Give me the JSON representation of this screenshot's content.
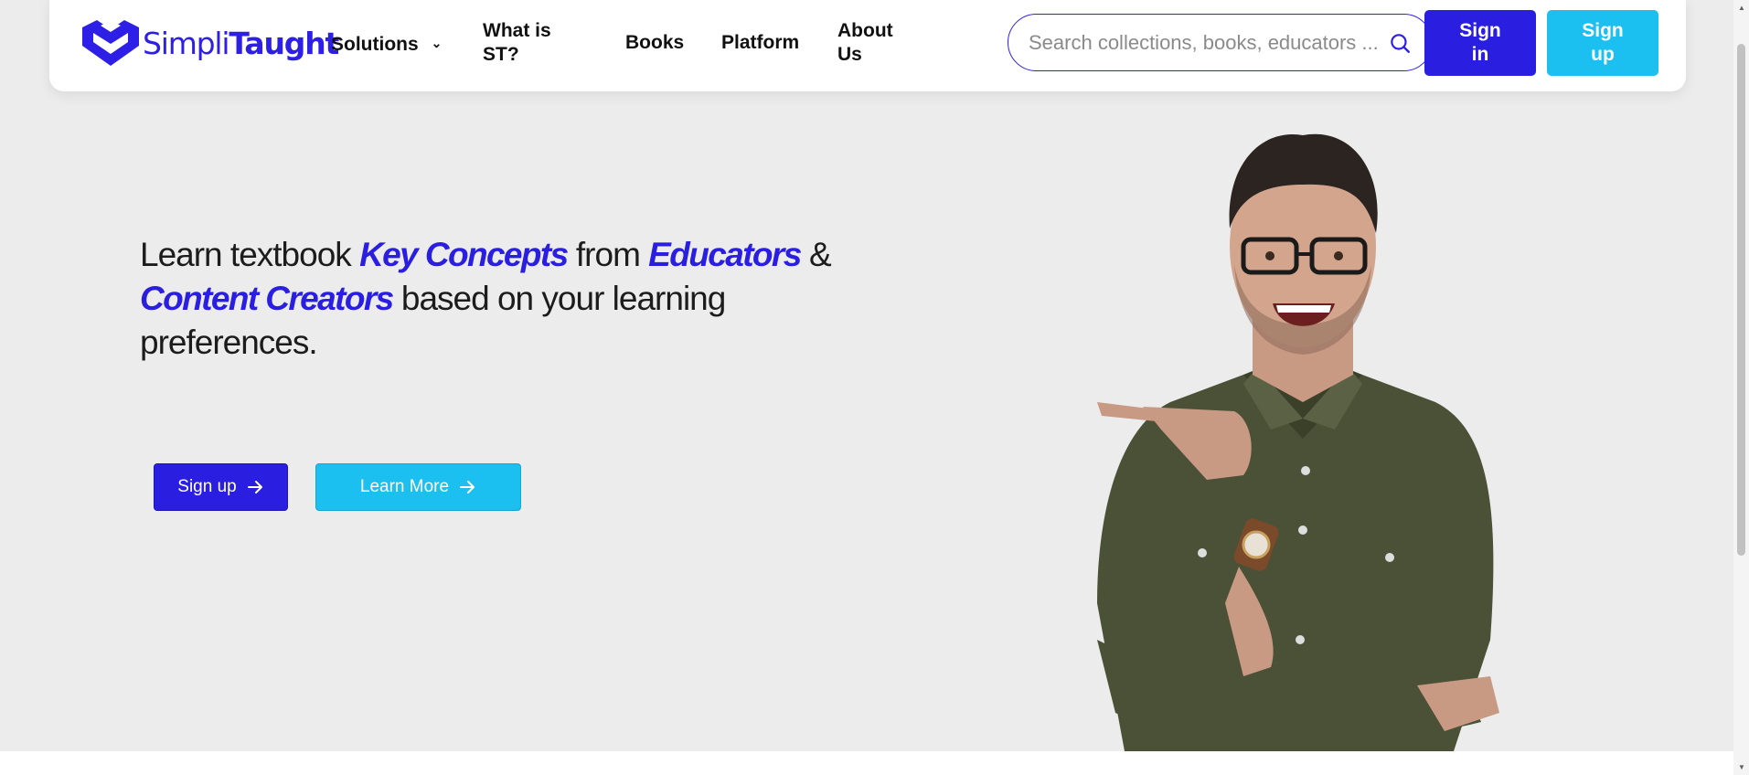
{
  "brand": {
    "name_light": "Simpli",
    "name_bold": "Taught",
    "color": "#2d1fe6"
  },
  "nav": {
    "solutions": "Solutions",
    "what_is_l1": "What is",
    "what_is_l2": "ST?",
    "books": "Books",
    "platform": "Platform",
    "about_l1": "About",
    "about_l2": "Us"
  },
  "search": {
    "placeholder": "Search collections, books, educators ..."
  },
  "auth": {
    "signin_l1": "Sign",
    "signin_l2": "in",
    "signup_l1": "Sign",
    "signup_l2": "up"
  },
  "hero": {
    "p1": "Learn textbook ",
    "em1": "Key Concepts",
    "p2": " from ",
    "em2": "Educators",
    "p3": " & ",
    "em3": "Content Creators",
    "p4": " based on your learning preferences.",
    "cta_signup": "Sign up",
    "cta_learn": "Learn More"
  },
  "colors": {
    "primary": "#2a1fe0",
    "accent": "#1bbff0",
    "background": "#ececec"
  }
}
